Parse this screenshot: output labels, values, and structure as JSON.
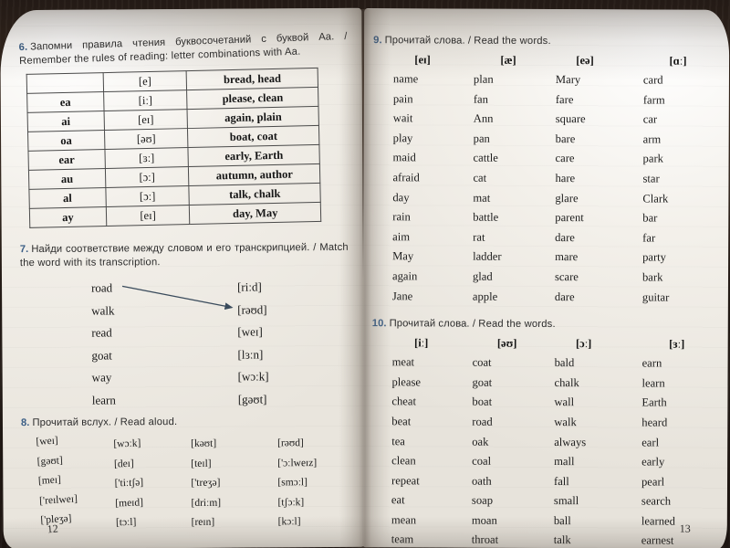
{
  "book": {
    "left_page_number": "12",
    "right_page_number": "13"
  },
  "exercise6": {
    "number": "6.",
    "text_ru": "Запомни правила чтения буквосочетаний с буквой Aa. /",
    "text_en": "Remember the rules of reading: letter combinations with Aa.",
    "table": {
      "rows": [
        {
          "letters": "",
          "transcription": "[e]",
          "words": "bread, head"
        },
        {
          "letters": "ea",
          "transcription": "[iː]",
          "words": "please, clean"
        },
        {
          "letters": "ai",
          "transcription": "[eɪ]",
          "words": "again, plain"
        },
        {
          "letters": "oa",
          "transcription": "[əʊ]",
          "words": "boat, coat"
        },
        {
          "letters": "ear",
          "transcription": "[ɜː]",
          "words": "early, Earth"
        },
        {
          "letters": "au",
          "transcription": "[ɔː]",
          "words": "autumn, author"
        },
        {
          "letters": "al",
          "transcription": "[ɔː]",
          "words": "talk, chalk"
        },
        {
          "letters": "ay",
          "transcription": "[eɪ]",
          "words": "day, May"
        }
      ]
    }
  },
  "exercise7": {
    "number": "7.",
    "text_ru": "Найди соответствие между словом и его транскрипцией. /",
    "text_en": "Match the word with its transcription.",
    "words": [
      "road",
      "walk",
      "read",
      "goat",
      "way",
      "learn"
    ],
    "transcriptions": [
      "[riːd]",
      "[rəʊd]",
      "[weɪ]",
      "[lɜːn]",
      "[wɔːk]",
      "[gəʊt]"
    ],
    "drawn_match": {
      "from": "road",
      "to": "[rəʊd]"
    }
  },
  "exercise8": {
    "number": "8.",
    "text_ru": "Прочитай вслух. /",
    "text_en": "Read aloud.",
    "columns": [
      [
        "[weɪ]",
        "[gəʊt]",
        "[meɪ]",
        "['reɪlweɪ]",
        "['pleʒə]"
      ],
      [
        "[wɔːk]",
        "[deɪ]",
        "['tiːtʃə]",
        "[meɪd]",
        "[tɔːl]"
      ],
      [
        "[kəʊt]",
        "[teɪl]",
        "['treʒə]",
        "[driːm]",
        "[reɪn]"
      ],
      [
        "[rəʊd]",
        "['ɔːlweɪz]",
        "[smɔːl]",
        "[tʃɔːk]",
        "[kɔːl]"
      ]
    ]
  },
  "exercise9": {
    "number": "9.",
    "text_ru": "Прочитай слова. /",
    "text_en": "Read the words.",
    "columns": [
      {
        "header": "[eɪ]",
        "words": [
          "name",
          "pain",
          "wait",
          "play",
          "maid",
          "afraid",
          "day",
          "rain",
          "aim",
          "May",
          "again",
          "Jane"
        ]
      },
      {
        "header": "[æ]",
        "words": [
          "plan",
          "fan",
          "Ann",
          "pan",
          "cattle",
          "cat",
          "mat",
          "battle",
          "rat",
          "ladder",
          "glad",
          "apple"
        ]
      },
      {
        "header": "[eə]",
        "words": [
          "Mary",
          "fare",
          "square",
          "bare",
          "care",
          "hare",
          "glare",
          "parent",
          "dare",
          "mare",
          "scare",
          "dare"
        ]
      },
      {
        "header": "[ɑː]",
        "words": [
          "card",
          "farm",
          "car",
          "arm",
          "park",
          "star",
          "Clark",
          "bar",
          "far",
          "party",
          "bark",
          "guitar"
        ]
      }
    ]
  },
  "exercise10": {
    "number": "10.",
    "text_ru": "Прочитай слова. /",
    "text_en": "Read the words.",
    "columns": [
      {
        "header": "[iː]",
        "words": [
          "meat",
          "please",
          "cheat",
          "beat",
          "tea",
          "clean",
          "repeat",
          "eat",
          "mean",
          "team"
        ]
      },
      {
        "header": "[əʊ]",
        "words": [
          "coat",
          "goat",
          "boat",
          "road",
          "oak",
          "coal",
          "oath",
          "soap",
          "moan",
          "throat"
        ]
      },
      {
        "header": "[ɔː]",
        "words": [
          "bald",
          "chalk",
          "wall",
          "walk",
          "always",
          "mall",
          "fall",
          "small",
          "ball",
          "talk"
        ]
      },
      {
        "header": "[ɜː]",
        "words": [
          "earn",
          "learn",
          "Earth",
          "heard",
          "earl",
          "early",
          "pearl",
          "search",
          "learned",
          "earnest"
        ]
      }
    ]
  },
  "colors": {
    "exercise_number": "#3c5f86",
    "page_paper": "#efece6",
    "backdrop": "#2b211c",
    "ink": "#1a1a1a"
  }
}
